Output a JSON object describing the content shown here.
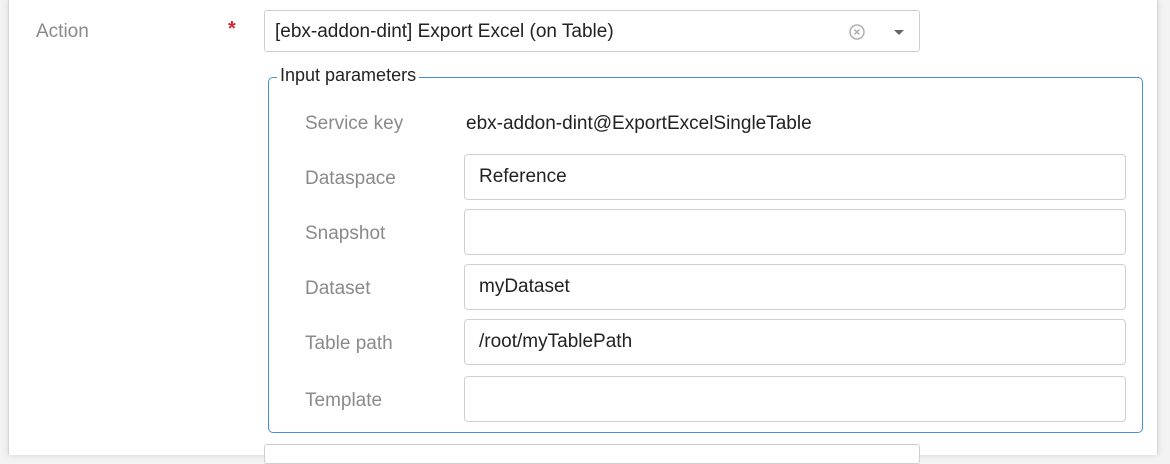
{
  "action": {
    "label": "Action",
    "required_mark": "*",
    "selected_value": "[ebx-addon-dint] Export Excel (on Table)"
  },
  "input_parameters": {
    "legend": "Input parameters",
    "service_key": {
      "label": "Service key",
      "value": "ebx-addon-dint@ExportExcelSingleTable"
    },
    "dataspace": {
      "label": "Dataspace",
      "value": "Reference"
    },
    "snapshot": {
      "label": "Snapshot",
      "value": ""
    },
    "dataset": {
      "label": "Dataset",
      "value": "myDataset"
    },
    "table_path": {
      "label": "Table path",
      "value": "/root/myTablePath"
    },
    "template": {
      "label": "Template",
      "value": ""
    }
  },
  "colors": {
    "accent_border": "#4a8fd4",
    "required": "#d9232e",
    "label_text": "#8a8a8a"
  },
  "icons": [
    "clear-icon",
    "chevron-down-icon"
  ]
}
